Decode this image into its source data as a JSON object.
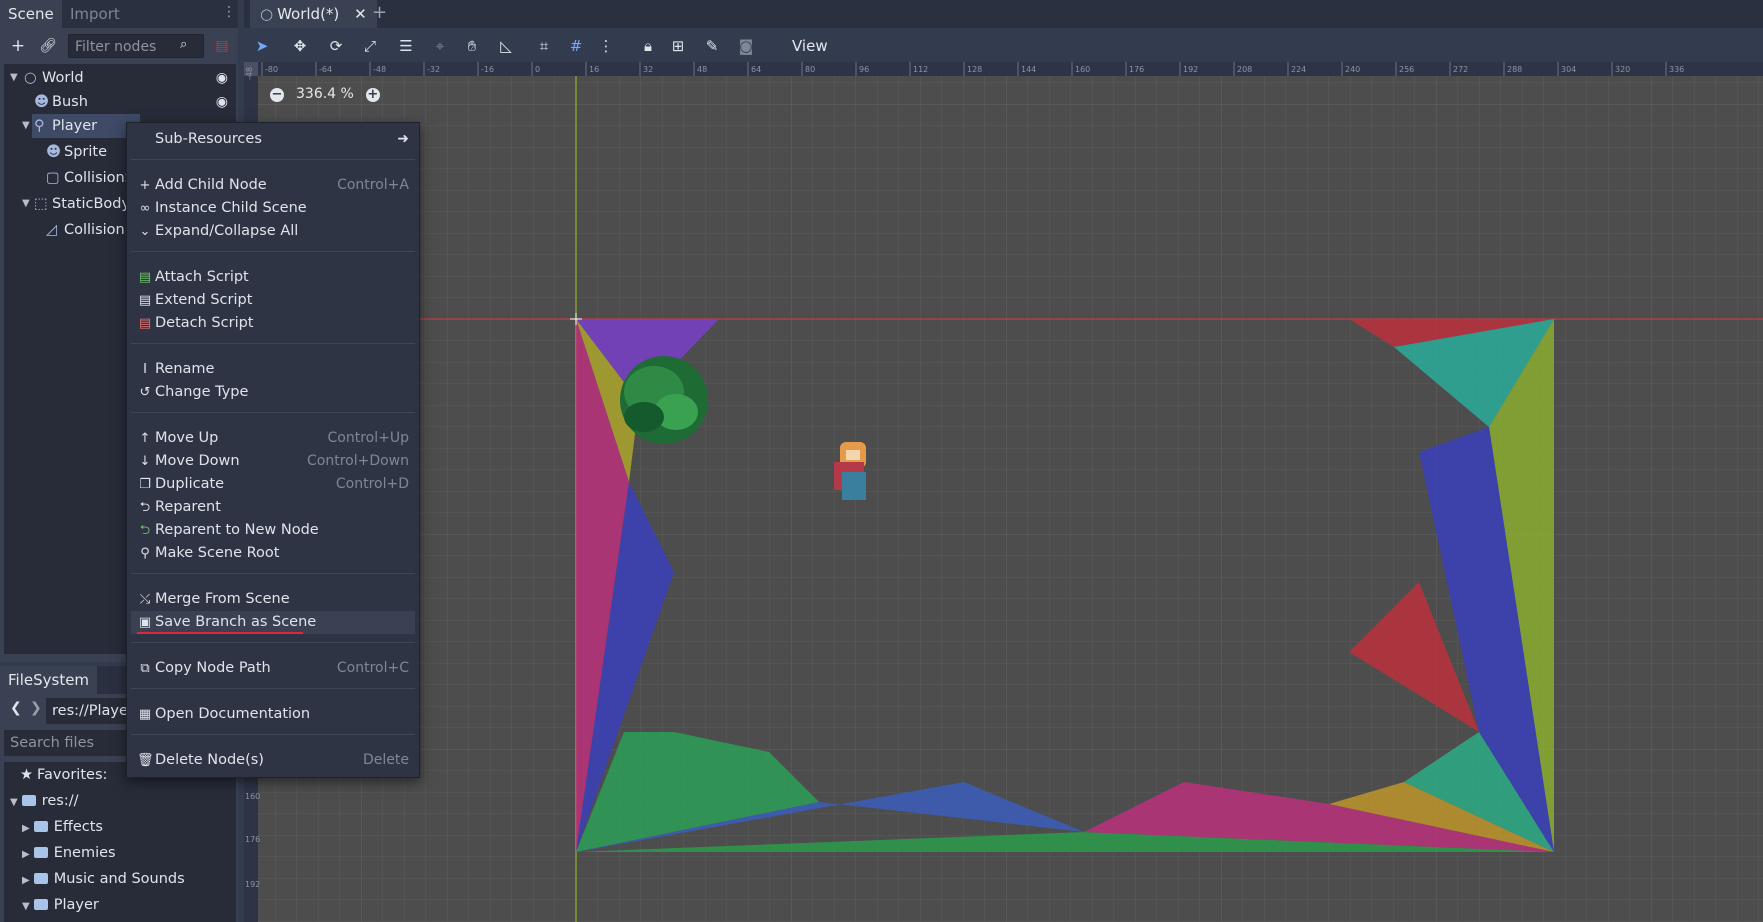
{
  "scene_dock": {
    "tabs": [
      "Scene",
      "Import"
    ],
    "filter_placeholder": "Filter nodes",
    "tree": [
      {
        "label": "World",
        "icon": "node2d-circle-icon"
      },
      {
        "label": "Bush",
        "icon": "sprite-icon"
      },
      {
        "label": "Player",
        "icon": "kinematic-body-icon"
      },
      {
        "label": "Sprite",
        "icon": "sprite-icon"
      },
      {
        "label": "CollisionS",
        "icon": "collision-shape-icon"
      },
      {
        "label": "StaticBody2",
        "icon": "static-body-icon"
      },
      {
        "label": "CollisionP",
        "icon": "collision-polygon-icon"
      }
    ]
  },
  "filesystem_dock": {
    "tab": "FileSystem",
    "path": "res://Player",
    "search_placeholder": "Search files",
    "favorites": "Favorites:",
    "root": "res://",
    "folders": [
      "Effects",
      "Enemies",
      "Music and Sounds",
      "Player"
    ]
  },
  "editor": {
    "scene_tab": "World(*)",
    "view_menu": "View",
    "zoom": "336.4 %",
    "ruler_top_ticks": [
      "-80",
      "-64",
      "-48",
      "-32",
      "-16",
      "0",
      "16",
      "32",
      "48",
      "64",
      "80",
      "96",
      "112",
      "128",
      "144",
      "160",
      "176",
      "192",
      "208",
      "224",
      "240",
      "256",
      "272",
      "288",
      "304",
      "320",
      "336"
    ],
    "ruler_left_ticks": [
      "-48",
      "160",
      "176",
      "192"
    ]
  },
  "context_menu": {
    "items": [
      {
        "label": "Sub-Resources",
        "icon": "",
        "shortcut": "",
        "submenu": true
      },
      {
        "label": "Add Child Node",
        "icon": "plus-icon",
        "shortcut": "Control+A"
      },
      {
        "label": "Instance Child Scene",
        "icon": "link-icon",
        "shortcut": ""
      },
      {
        "label": "Expand/Collapse All",
        "icon": "chevron-down-icon",
        "shortcut": ""
      },
      {
        "label": "Attach Script",
        "icon": "script-add-icon",
        "shortcut": ""
      },
      {
        "label": "Extend Script",
        "icon": "script-extend-icon",
        "shortcut": ""
      },
      {
        "label": "Detach Script",
        "icon": "script-remove-icon",
        "shortcut": ""
      },
      {
        "label": "Rename",
        "icon": "text-cursor-icon",
        "shortcut": ""
      },
      {
        "label": "Change Type",
        "icon": "reload-icon",
        "shortcut": ""
      },
      {
        "label": "Move Up",
        "icon": "arrow-up-icon",
        "shortcut": "Control+Up"
      },
      {
        "label": "Move Down",
        "icon": "arrow-down-icon",
        "shortcut": "Control+Down"
      },
      {
        "label": "Duplicate",
        "icon": "duplicate-icon",
        "shortcut": "Control+D"
      },
      {
        "label": "Reparent",
        "icon": "reparent-icon",
        "shortcut": ""
      },
      {
        "label": "Reparent to New Node",
        "icon": "reparent-new-icon",
        "shortcut": ""
      },
      {
        "label": "Make Scene Root",
        "icon": "scene-root-icon",
        "shortcut": ""
      },
      {
        "label": "Merge From Scene",
        "icon": "merge-icon",
        "shortcut": ""
      },
      {
        "label": "Save Branch as Scene",
        "icon": "save-branch-icon",
        "shortcut": ""
      },
      {
        "label": "Copy Node Path",
        "icon": "copy-path-icon",
        "shortcut": "Control+C"
      },
      {
        "label": "Open Documentation",
        "icon": "help-icon",
        "shortcut": ""
      },
      {
        "label": "Delete Node(s)",
        "icon": "trash-icon",
        "shortcut": "Delete"
      }
    ]
  },
  "colors": {
    "accent": "#e0283a",
    "highlight": "#3a4152"
  }
}
